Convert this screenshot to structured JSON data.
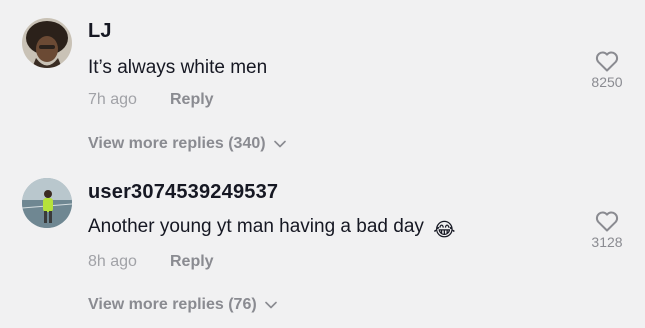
{
  "comments": [
    {
      "username": "LJ",
      "text": "It’s always white men",
      "time": "7h ago",
      "reply_label": "Reply",
      "likes": "8250",
      "view_more": "View more replies (340)"
    },
    {
      "username": "user3074539249537",
      "text": "Another young yt man having a bad day",
      "emoji": "😂",
      "time": "8h ago",
      "reply_label": "Reply",
      "likes": "3128",
      "view_more": "View more replies (76)"
    }
  ],
  "icons": {
    "like": "heart-outline-icon",
    "expand": "chevron-down-icon"
  },
  "colors": {
    "background": "#f1f1f2",
    "primary_text": "#161823",
    "secondary_text": "#8a8b91"
  }
}
